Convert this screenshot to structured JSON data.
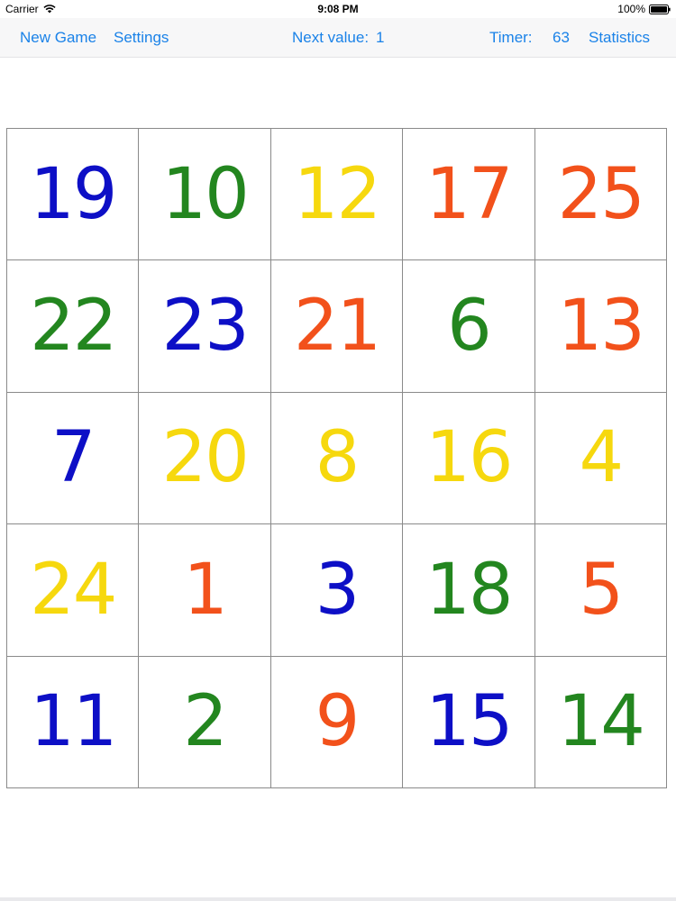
{
  "status_bar": {
    "carrier": "Carrier",
    "time": "9:08 PM",
    "battery": "100%",
    "icons": [
      "wifi-icon",
      "battery-icon"
    ]
  },
  "toolbar": {
    "new_game": "New Game",
    "settings": "Settings",
    "next_value_label": "Next value:",
    "next_value": "1",
    "timer_label": "Timer:",
    "timer_value": "63",
    "statistics": "Statistics"
  },
  "colors": {
    "blue": "#0d0fc6",
    "green": "#23861f",
    "yellow": "#f6d80e",
    "orange": "#f2511b",
    "link": "#1a82e8"
  },
  "board": {
    "cells": [
      {
        "value": "19",
        "color": "blue"
      },
      {
        "value": "10",
        "color": "green"
      },
      {
        "value": "12",
        "color": "yellow"
      },
      {
        "value": "17",
        "color": "orange"
      },
      {
        "value": "25",
        "color": "orange"
      },
      {
        "value": "22",
        "color": "green"
      },
      {
        "value": "23",
        "color": "blue"
      },
      {
        "value": "21",
        "color": "orange"
      },
      {
        "value": "6",
        "color": "green"
      },
      {
        "value": "13",
        "color": "orange"
      },
      {
        "value": "7",
        "color": "blue"
      },
      {
        "value": "20",
        "color": "yellow"
      },
      {
        "value": "8",
        "color": "yellow"
      },
      {
        "value": "16",
        "color": "yellow"
      },
      {
        "value": "4",
        "color": "yellow"
      },
      {
        "value": "24",
        "color": "yellow"
      },
      {
        "value": "1",
        "color": "orange"
      },
      {
        "value": "3",
        "color": "blue"
      },
      {
        "value": "18",
        "color": "green"
      },
      {
        "value": "5",
        "color": "orange"
      },
      {
        "value": "11",
        "color": "blue"
      },
      {
        "value": "2",
        "color": "green"
      },
      {
        "value": "9",
        "color": "orange"
      },
      {
        "value": "15",
        "color": "blue"
      },
      {
        "value": "14",
        "color": "green"
      }
    ]
  }
}
